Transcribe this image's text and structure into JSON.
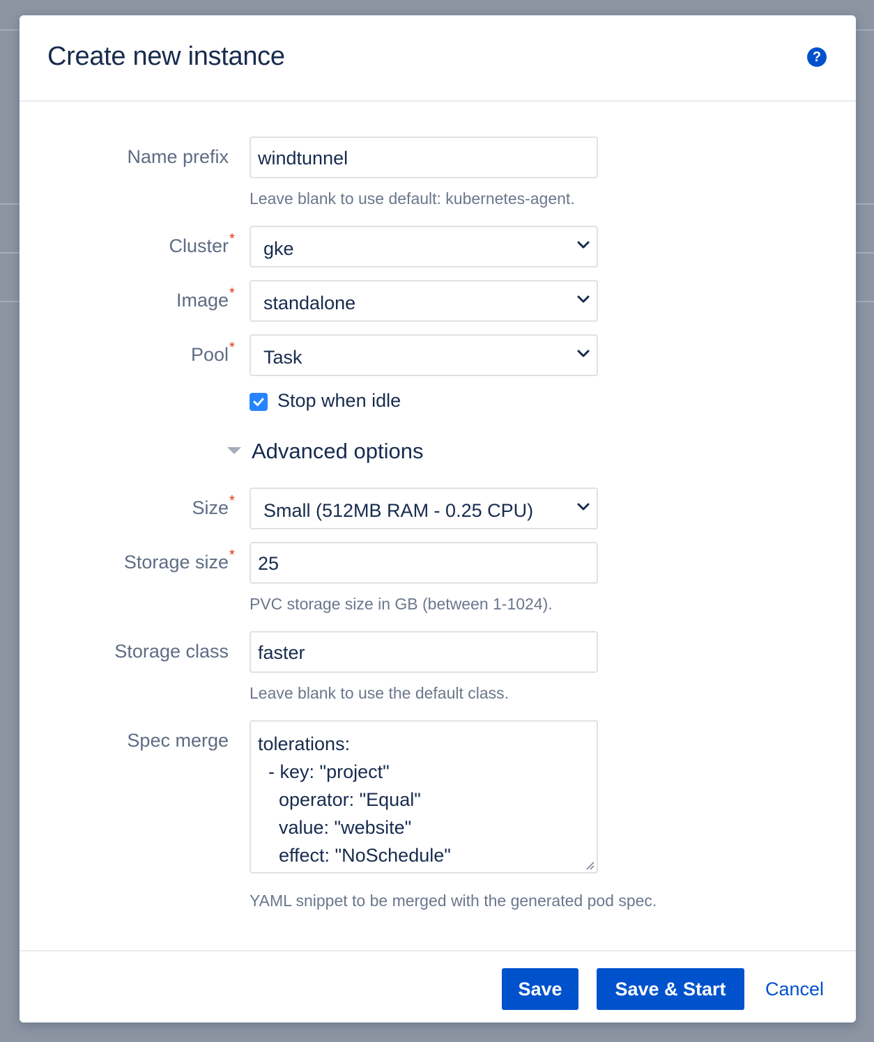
{
  "dialog": {
    "title": "Create new instance",
    "help_icon": "question-circle-icon"
  },
  "form": {
    "name_prefix": {
      "label": "Name prefix",
      "value": "windtunnel",
      "help": "Leave blank to use default: kubernetes-agent."
    },
    "cluster": {
      "label": "Cluster",
      "required": "*",
      "value": "gke"
    },
    "image": {
      "label": "Image",
      "required": "*",
      "value": "standalone"
    },
    "pool": {
      "label": "Pool",
      "required": "*",
      "value": "Task"
    },
    "stop_when_idle": {
      "label": "Stop when idle",
      "checked": true
    },
    "advanced": {
      "title": "Advanced options",
      "expanded": true
    },
    "size": {
      "label": "Size",
      "required": "*",
      "value": "Small (512MB RAM - 0.25 CPU)"
    },
    "storage_size": {
      "label": "Storage size",
      "required": "*",
      "value": "25",
      "help": "PVC storage size in GB (between 1-1024)."
    },
    "storage_class": {
      "label": "Storage class",
      "value": "faster",
      "help": "Leave blank to use the default class."
    },
    "spec_merge": {
      "label": "Spec merge",
      "value": "tolerations:\n  - key: \"project\"\n    operator: \"Equal\"\n    value: \"website\"\n    effect: \"NoSchedule\"",
      "help": "YAML snippet to be merged with the generated pod spec."
    }
  },
  "footer": {
    "save": "Save",
    "save_start": "Save & Start",
    "cancel": "Cancel"
  },
  "colors": {
    "primary": "#0052cc",
    "required": "#de350b",
    "checkbox": "#2684ff",
    "title": "#172b4d",
    "muted": "#6b778c"
  }
}
